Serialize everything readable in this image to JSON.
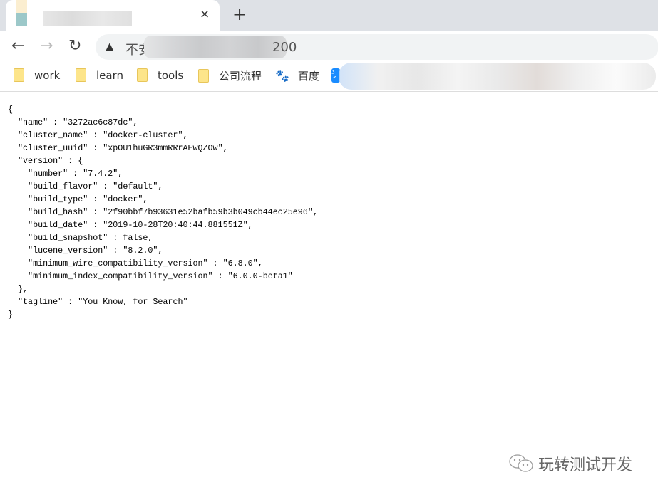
{
  "browser": {
    "tab_close": "×",
    "new_tab": "+",
    "address_prefix": "不安",
    "address_suffix": "200",
    "nav": {
      "back": "←",
      "forward": "→",
      "reload": "↻"
    },
    "bookmarks": [
      {
        "label": "work",
        "icon": "folder-icon"
      },
      {
        "label": "learn",
        "icon": "folder-icon"
      },
      {
        "label": "tools",
        "icon": "folder-icon"
      },
      {
        "label": "公司流程",
        "icon": "folder-icon"
      },
      {
        "label": "百度",
        "icon": "baidu-paw-icon"
      }
    ],
    "bookmark_partial": "讠"
  },
  "json_body": [
    "{",
    "  \"name\" : \"3272ac6c87dc\",",
    "  \"cluster_name\" : \"docker-cluster\",",
    "  \"cluster_uuid\" : \"xpOU1huGR3mmRRrAEwQZOw\",",
    "  \"version\" : {",
    "    \"number\" : \"7.4.2\",",
    "    \"build_flavor\" : \"default\",",
    "    \"build_type\" : \"docker\",",
    "    \"build_hash\" : \"2f90bbf7b93631e52bafb59b3b049cb44ec25e96\",",
    "    \"build_date\" : \"2019-10-28T20:40:44.881551Z\",",
    "    \"build_snapshot\" : false,",
    "    \"lucene_version\" : \"8.2.0\",",
    "    \"minimum_wire_compatibility_version\" : \"6.8.0\",",
    "    \"minimum_index_compatibility_version\" : \"6.0.0-beta1\"",
    "  },",
    "  \"tagline\" : \"You Know, for Search\"",
    "}"
  ],
  "watermark": "玩转测试开发"
}
